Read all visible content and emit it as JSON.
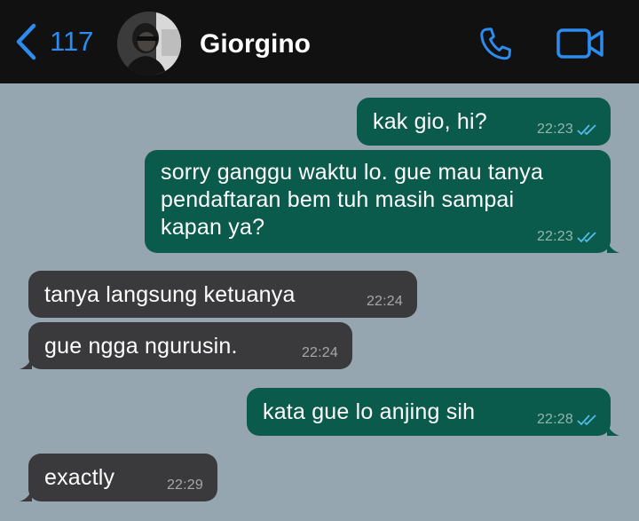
{
  "header": {
    "back_count": "117",
    "contact_name": "Giorgino",
    "icons": {
      "back": "chevron-left-icon",
      "call": "phone-icon",
      "video": "video-camera-icon"
    },
    "accent_color": "#2d8cf0"
  },
  "colors": {
    "background": "#96a6b0",
    "outgoing_bubble": "#0b5b4d",
    "incoming_bubble": "#3a3a3c",
    "read_ticks": "#53bdeb"
  },
  "messages": [
    {
      "direction": "outgoing",
      "text": "kak gio, hi?",
      "time": "22:23",
      "status": "read"
    },
    {
      "direction": "outgoing",
      "lines": [
        "sorry ganggu waktu lo. gue mau tanya",
        "pendaftaran bem tuh masih sampai",
        "kapan ya?"
      ],
      "time": "22:23",
      "status": "read"
    },
    {
      "direction": "incoming",
      "text": "tanya langsung ketuanya",
      "time": "22:24"
    },
    {
      "direction": "incoming",
      "text": "gue ngga ngurusin.",
      "time": "22:24"
    },
    {
      "direction": "outgoing",
      "text": "kata gue lo anjing sih",
      "time": "22:28",
      "status": "read"
    },
    {
      "direction": "incoming",
      "text": "exactly",
      "time": "22:29"
    }
  ]
}
